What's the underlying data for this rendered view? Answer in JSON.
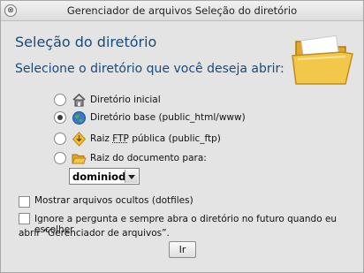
{
  "window": {
    "title": "Gerenciador de arquivos Seleção do diretório",
    "close_glyph": "⊗"
  },
  "heading": "Seleção do diretório",
  "subheading": "Selecione o diretório que você deseja abrir:",
  "options": [
    {
      "label": "Diretório inicial",
      "icon": "home-icon",
      "checked": false
    },
    {
      "label": "Diretório base (public_html/www)",
      "icon": "globe-icon",
      "checked": true
    },
    {
      "label_pre": "Raiz ",
      "label_abbr": "FTP",
      "label_post": " pública (public_ftp)",
      "icon": "ftp-arrows-icon",
      "checked": false
    },
    {
      "label": "Raiz do documento para:",
      "icon": "open-folder-icon",
      "checked": false
    }
  ],
  "domain_select": {
    "value": "dominiod"
  },
  "show_hidden": {
    "label": "Mostrar arquivos ocultos (dotfiles)",
    "checked": false
  },
  "skip_question": {
    "line1": "Ignore a pergunta e sempre abra o diretório no futuro quando eu escolher",
    "line2": "abrir “Gerenciador de arquivos”.",
    "checked": false
  },
  "go_button": "Ir",
  "colors": {
    "heading": "#1a4a7a",
    "background": "#e4e4e4",
    "folder": "#f3c84a"
  }
}
